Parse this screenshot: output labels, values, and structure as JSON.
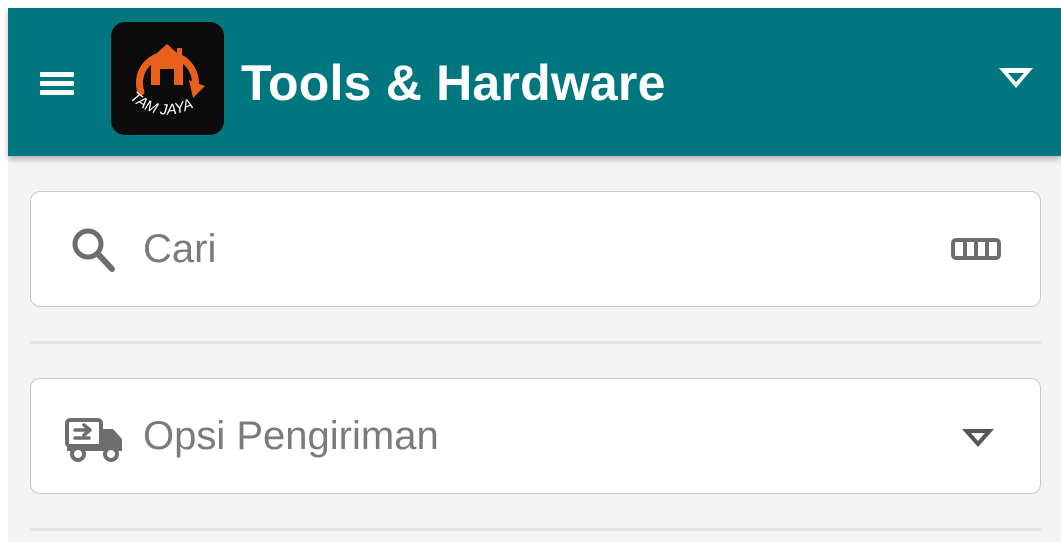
{
  "app_bar": {
    "title": "Tools & Hardware",
    "logo_text": "TAM JAYA",
    "background_color": "#00767f",
    "menu_icon": "hamburger-menu-icon",
    "dropdown_icon": "caret-down-icon"
  },
  "search": {
    "placeholder": "Cari",
    "value": "",
    "icon": "search-icon",
    "scan_icon": "barcode-scan-icon"
  },
  "shipping": {
    "label": "Opsi Pengiriman",
    "icon": "delivery-truck-icon",
    "dropdown_icon": "caret-down-icon"
  },
  "colors": {
    "app_bar": "#00767f",
    "logo_accent": "#e8601c",
    "field_border": "#c8c8c8",
    "placeholder_text": "#7b7b7b",
    "icon_gray": "#6e6e6e"
  }
}
